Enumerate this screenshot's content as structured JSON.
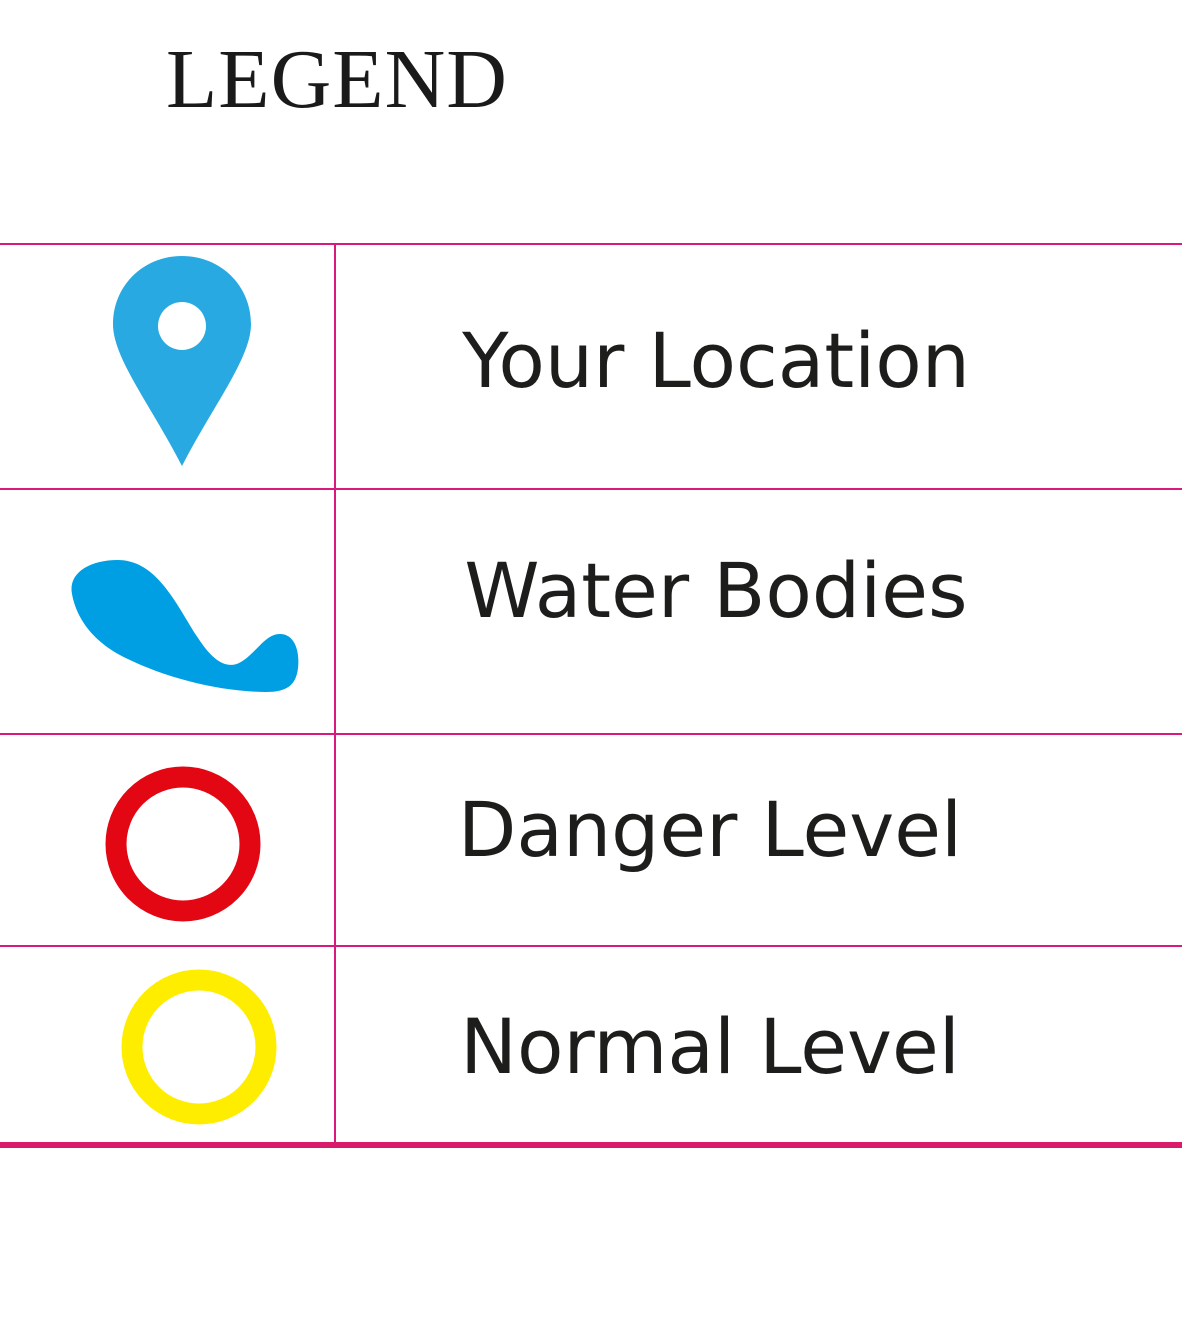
{
  "legend": {
    "title": "LEGEND",
    "items": [
      {
        "label": "Your Location",
        "icon": "location-pin-icon",
        "color": "#29a9e1"
      },
      {
        "label": "Water Bodies",
        "icon": "water-body-icon",
        "color": "#009fe3"
      },
      {
        "label": "Danger Level",
        "icon": "red-circle-icon",
        "color": "#e30613"
      },
      {
        "label": "Normal Level",
        "icon": "yellow-circle-icon",
        "color": "#ffed00"
      }
    ]
  },
  "colors": {
    "rule_lines": "#d81b7a",
    "text": "#1d1d1b"
  }
}
